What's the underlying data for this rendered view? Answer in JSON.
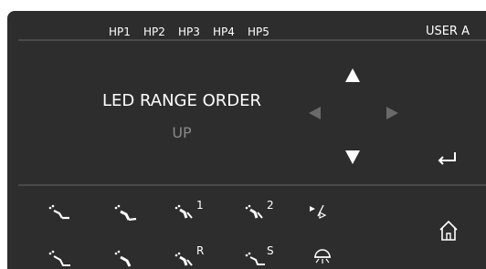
{
  "header": {
    "handpieces": [
      "HP1",
      "HP2",
      "HP3",
      "HP4",
      "HP5"
    ],
    "user": "USER A"
  },
  "setting": {
    "title": "LED RANGE ORDER",
    "value": "UP"
  },
  "icons": {
    "instrument_1_num": "1",
    "instrument_2_num": "2",
    "instrument_r": "R",
    "instrument_s": "S"
  },
  "colors": {
    "panel": "#2d2d2d",
    "text": "#ffffff",
    "muted": "#8a8a8a",
    "divider": "#4a4a4a",
    "disabled_arrow": "#6a6a6a"
  }
}
